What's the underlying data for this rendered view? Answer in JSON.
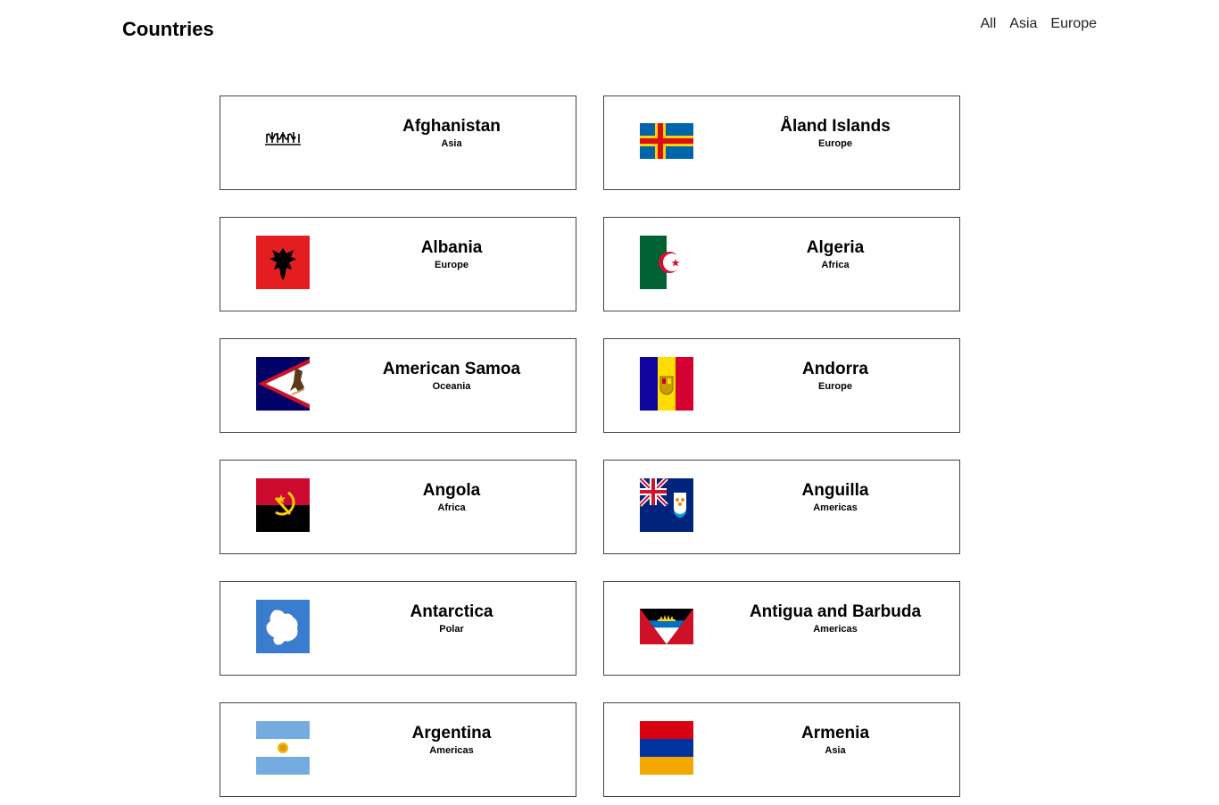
{
  "header": {
    "title": "Countries",
    "nav": [
      {
        "label": "All"
      },
      {
        "label": "Asia"
      },
      {
        "label": "Europe"
      }
    ]
  },
  "countries": [
    {
      "name": "Afghanistan",
      "region": "Asia",
      "flag_icon": "afghanistan-flag-icon"
    },
    {
      "name": "Åland Islands",
      "region": "Europe",
      "flag_icon": "aland-islands-flag-icon"
    },
    {
      "name": "Albania",
      "region": "Europe",
      "flag_icon": "albania-flag-icon"
    },
    {
      "name": "Algeria",
      "region": "Africa",
      "flag_icon": "algeria-flag-icon"
    },
    {
      "name": "American Samoa",
      "region": "Oceania",
      "flag_icon": "american-samoa-flag-icon"
    },
    {
      "name": "Andorra",
      "region": "Europe",
      "flag_icon": "andorra-flag-icon"
    },
    {
      "name": "Angola",
      "region": "Africa",
      "flag_icon": "angola-flag-icon"
    },
    {
      "name": "Anguilla",
      "region": "Americas",
      "flag_icon": "anguilla-flag-icon"
    },
    {
      "name": "Antarctica",
      "region": "Polar",
      "flag_icon": "antarctica-flag-icon"
    },
    {
      "name": "Antigua and Barbuda",
      "region": "Americas",
      "flag_icon": "antigua-and-barbuda-flag-icon"
    },
    {
      "name": "Argentina",
      "region": "Americas",
      "flag_icon": "argentina-flag-icon"
    },
    {
      "name": "Armenia",
      "region": "Asia",
      "flag_icon": "armenia-flag-icon"
    }
  ]
}
